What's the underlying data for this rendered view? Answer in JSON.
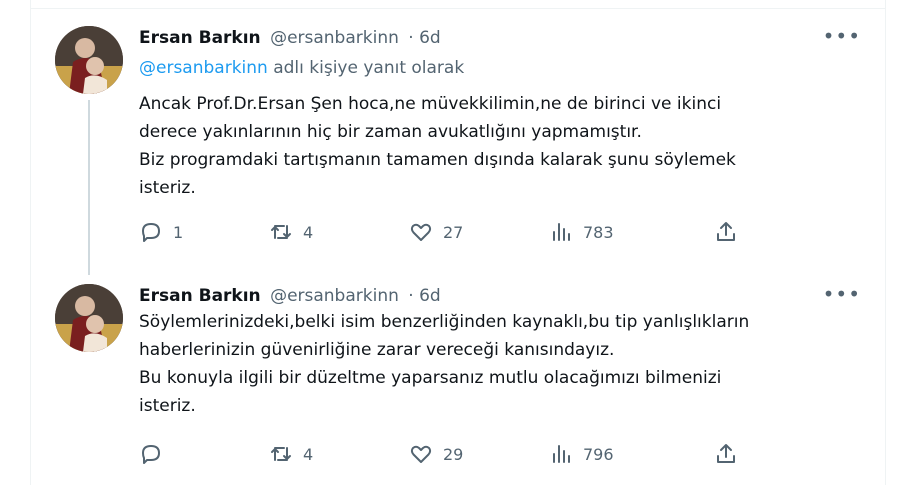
{
  "tweets": [
    {
      "name": "Ersan Barkın",
      "handle": "@ersanbarkinn",
      "time": "· 6d",
      "reply_link": "@ersanbarkinn",
      "reply_suffix": "adlı kişiye yanıt olarak",
      "lines": [
        "Ancak Prof.Dr.Ersan Şen hoca,ne müvekkilimin,ne de birinci ve ikinci",
        "derece yakınlarının hiç bir zaman avukatlığını yapmamıştır.",
        "Biz programdaki tartışmanın tamamen dışında kalarak şunu söylemek",
        "isteriz."
      ],
      "replies": "1",
      "retweets": "4",
      "likes": "27",
      "views": "783"
    },
    {
      "name": "Ersan Barkın",
      "handle": "@ersanbarkinn",
      "time": "· 6d",
      "lines": [
        "Söylemlerinizdeki,belki isim benzerliğinden kaynaklı,bu tip yanlışlıkların",
        "haberlerinizin güvenirliğine zarar vereceği kanısındayız.",
        "Bu konuyla ilgili bir düzeltme yaparsanız mutlu olacağımızı bilmenizi",
        "isteriz."
      ],
      "replies": "",
      "retweets": "4",
      "likes": "29",
      "views": "796"
    }
  ],
  "more_label": "•••",
  "icons": [
    "reply-icon",
    "retweet-icon",
    "like-icon",
    "views-icon",
    "share-icon",
    "more-icon"
  ],
  "colors": {
    "link": "#1d9bf0",
    "muted": "#536471",
    "text": "#0f1419"
  }
}
